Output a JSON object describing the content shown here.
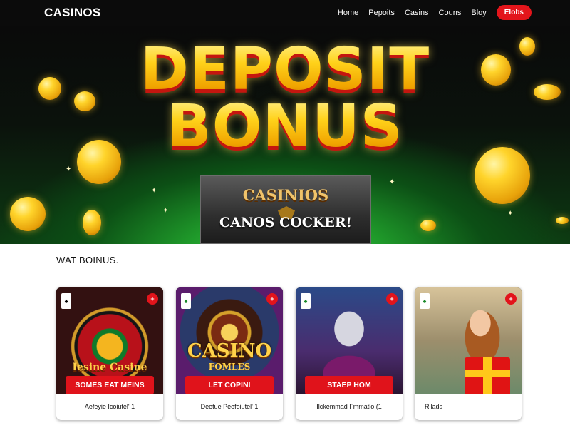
{
  "nav": {
    "brand": "CASINOS",
    "links": [
      "Home",
      "Pepoits",
      "Casins",
      "Couns",
      "Bloy"
    ],
    "cta": "Elobs"
  },
  "hero": {
    "title_line1": "DEPOSIT",
    "title_line2": "BONUS",
    "banner_top": "CASINIOS",
    "banner_bottom": "CANOS COCKER!"
  },
  "section": {
    "title": "WAT BOINUS."
  },
  "cards": [
    {
      "art_title": "Iesine Casine",
      "button": "SOMES EAT MEINS",
      "caption": "Aefeyie Icoiutel' 1",
      "tag": "♠",
      "badge": "+"
    },
    {
      "art_title": "CASINO",
      "art_subtitle": "FOMLES",
      "button": "LET COPINI",
      "caption": "Deetue Peefoiutel' 1",
      "tag": "♠",
      "badge": "+"
    },
    {
      "art_title": "",
      "button": "STAEP HOM",
      "caption": "Ilckemmad Fmmatlo (1",
      "tag": "♠",
      "badge": "+"
    },
    {
      "art_title": "",
      "button": "",
      "caption": "Rilads",
      "tag": "♠",
      "badge": "+"
    }
  ],
  "colors": {
    "accent_red": "#e0131b",
    "gold": "#ffd21a",
    "hero_green": "#1f9a2a",
    "nav_bg": "#0b0b0b"
  }
}
